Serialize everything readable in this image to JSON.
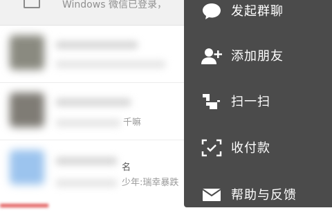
{
  "banner": {
    "text": "Windows 微信已登录，",
    "icon": "monitor-icon"
  },
  "chats": [
    {
      "preview": "",
      "title": ""
    },
    {
      "preview": "千嘛",
      "title": ""
    },
    {
      "preview": "少年:瑞幸暴跌",
      "title": "名"
    }
  ],
  "menu": {
    "items": [
      {
        "label": "发起群聊",
        "icon": "chat-bubble-icon"
      },
      {
        "label": "添加朋友",
        "icon": "add-friend-icon"
      },
      {
        "label": "扫一扫",
        "icon": "scan-icon"
      },
      {
        "label": "收付款",
        "icon": "payment-icon"
      },
      {
        "label": "帮助与反馈",
        "icon": "mail-icon"
      }
    ]
  },
  "colors": {
    "menu_bg": "#4b4b4b",
    "menu_text": "#ffffff",
    "list_bg": "#ffffff"
  }
}
